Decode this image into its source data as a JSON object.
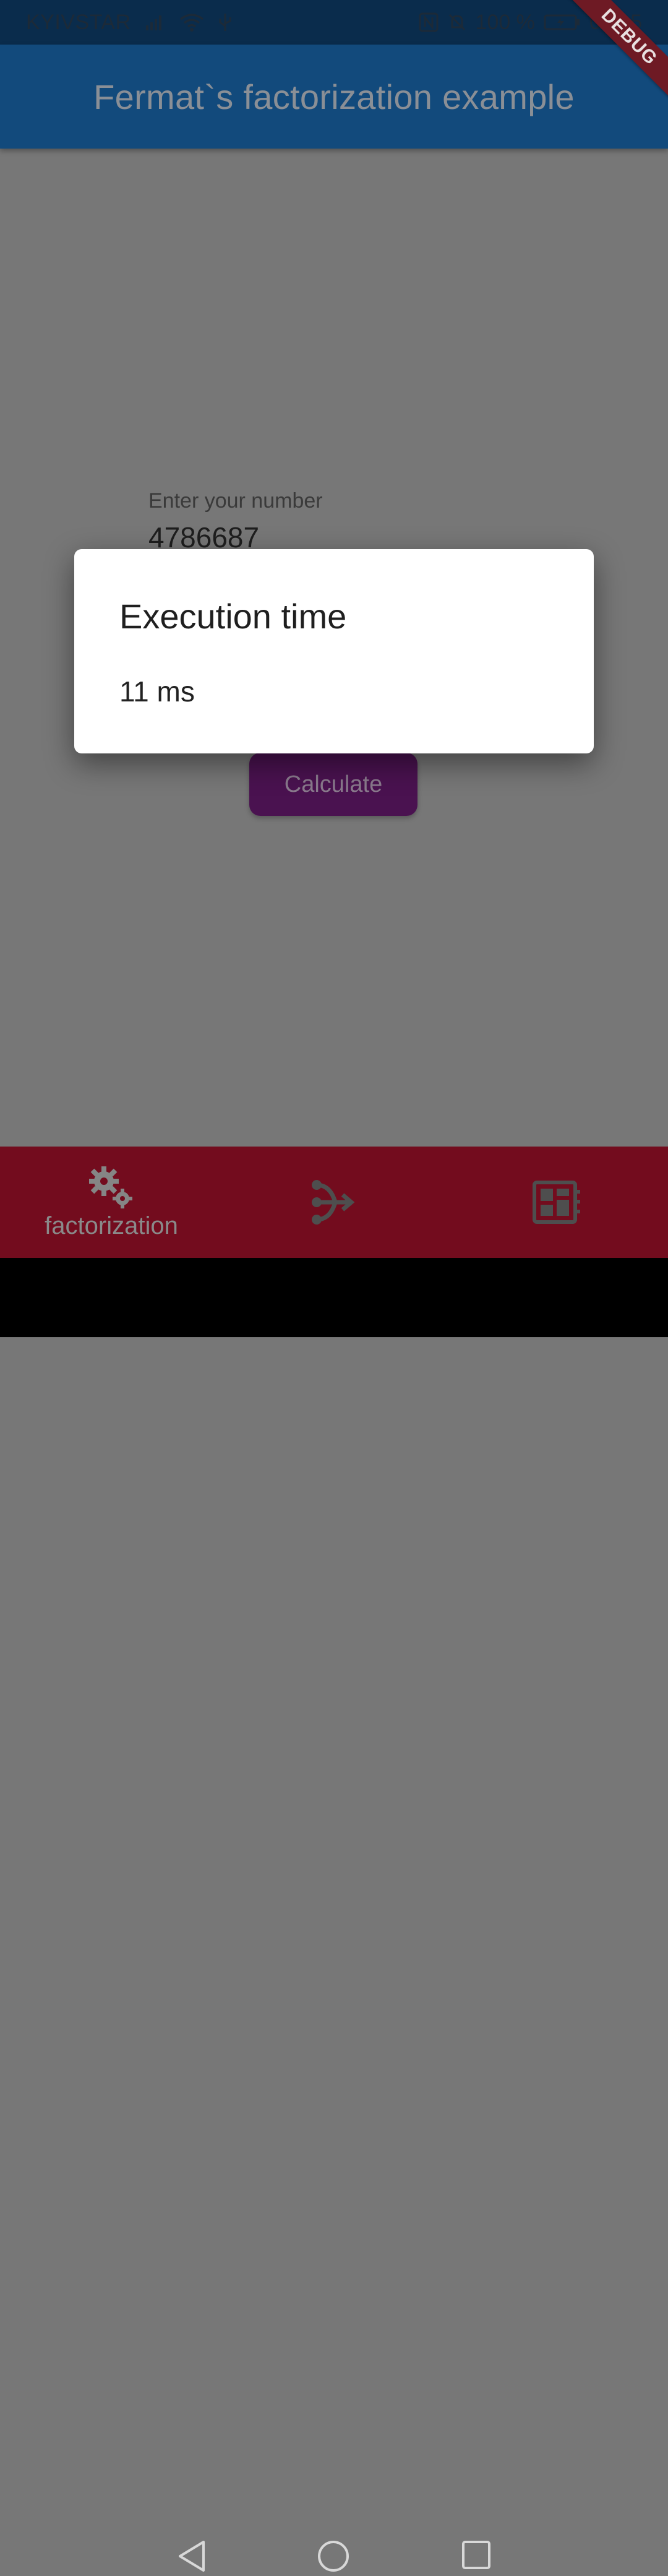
{
  "status_bar": {
    "carrier": "KYIVSTAR",
    "battery": "100 %",
    "time": "05:15",
    "icons": [
      "signal-icon",
      "wifi-icon",
      "usb-icon",
      "nfc-icon",
      "mute-icon",
      "battery-icon"
    ]
  },
  "debug_banner": "DEBUG",
  "app_bar": {
    "title": "Fermat`s factorization example"
  },
  "input": {
    "label": "Enter your number",
    "value": "4786687"
  },
  "calculate_button": "Calculate",
  "dialog": {
    "title": "Execution time",
    "body": "11 ms"
  },
  "bottom_nav": {
    "items": [
      {
        "label": "factorization",
        "icon": "gears-icon",
        "selected": true
      },
      {
        "label": "",
        "icon": "split-arrow-icon",
        "selected": false
      },
      {
        "label": "",
        "icon": "dashboard-icon",
        "selected": false
      }
    ]
  },
  "colors": {
    "status_bar": "#0a2c4c",
    "app_bar": "#124a7c",
    "scrim_background": "#777777",
    "button": "#4a1250",
    "bottom_nav": "#730c1e",
    "debug_ribbon": "#6e1a24"
  }
}
